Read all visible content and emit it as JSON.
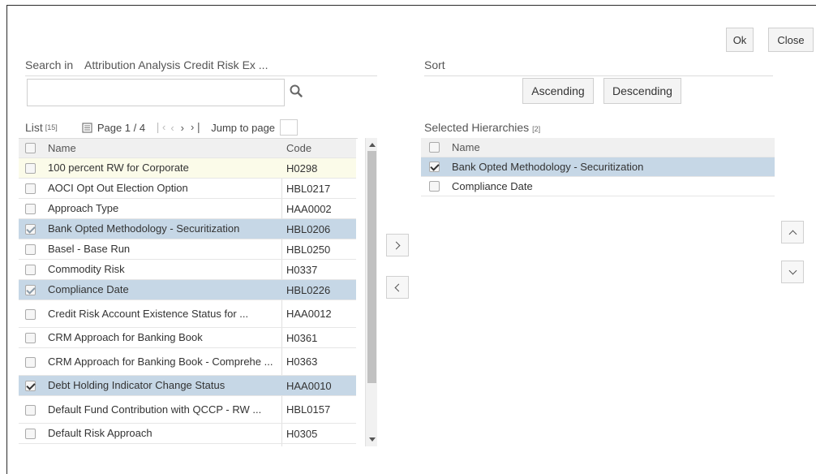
{
  "buttons": {
    "ok": "Ok",
    "close": "Close",
    "ascending": "Ascending",
    "descending": "Descending"
  },
  "search": {
    "label": "Search in",
    "scope": "Attribution Analysis Credit Risk Ex ...",
    "value": ""
  },
  "sort": {
    "label": "Sort"
  },
  "list": {
    "label": "List",
    "count": "[15]",
    "page_text": "Page 1 / 4",
    "jump_label": "Jump to page",
    "jump_value": "",
    "columns": {
      "name": "Name",
      "code": "Code"
    },
    "rows": [
      {
        "name": "100 percent RW for Corporate",
        "code": "H0298",
        "checked": false,
        "state": "highlight"
      },
      {
        "name": "AOCI Opt Out Election Option",
        "code": "HBL0217",
        "checked": false,
        "state": ""
      },
      {
        "name": "Approach Type",
        "code": "HAA0002",
        "checked": false,
        "state": ""
      },
      {
        "name": "Bank Opted Methodology - Securitization",
        "code": "HBL0206",
        "checked": true,
        "state": "selected"
      },
      {
        "name": "Basel - Base Run",
        "code": "HBL0250",
        "checked": false,
        "state": ""
      },
      {
        "name": "Commodity Risk",
        "code": "H0337",
        "checked": false,
        "state": ""
      },
      {
        "name": "Compliance Date",
        "code": "HBL0226",
        "checked": true,
        "state": "selected"
      },
      {
        "name": "Credit Risk Account Existence Status for ...",
        "code": "HAA0012",
        "checked": false,
        "state": ""
      },
      {
        "name": "CRM Approach for Banking Book",
        "code": "H0361",
        "checked": false,
        "state": ""
      },
      {
        "name": "CRM Approach for Banking Book - Comprehe ...",
        "code": "H0363",
        "checked": false,
        "state": ""
      },
      {
        "name": "Debt Holding Indicator Change Status",
        "code": "HAA0010",
        "checked": true,
        "state": "selected"
      },
      {
        "name": "Default Fund Contribution with QCCP - RW ...",
        "code": "HBL0157",
        "checked": false,
        "state": ""
      },
      {
        "name": "Default Risk Approach",
        "code": "H0305",
        "checked": false,
        "state": ""
      }
    ]
  },
  "selected": {
    "label": "Selected Hierarchies",
    "count": "[2]",
    "columns": {
      "name": "Name"
    },
    "rows": [
      {
        "name": "Bank Opted Methodology - Securitization",
        "checked": true,
        "state": "selected"
      },
      {
        "name": "Compliance Date",
        "checked": false,
        "state": ""
      }
    ]
  },
  "icons": {
    "search": "search-icon",
    "page": "page-icon",
    "first": "first-page-icon",
    "prev": "prev-page-icon",
    "next": "next-page-icon",
    "last": "last-page-icon",
    "move_right": "move-right-icon",
    "move_left": "move-left-icon",
    "move_up": "move-up-icon",
    "move_down": "move-down-icon"
  },
  "colors": {
    "selected_row": "#c6d7e6",
    "highlight_row": "#fbfbe9",
    "header_row": "#f0f0f0"
  }
}
